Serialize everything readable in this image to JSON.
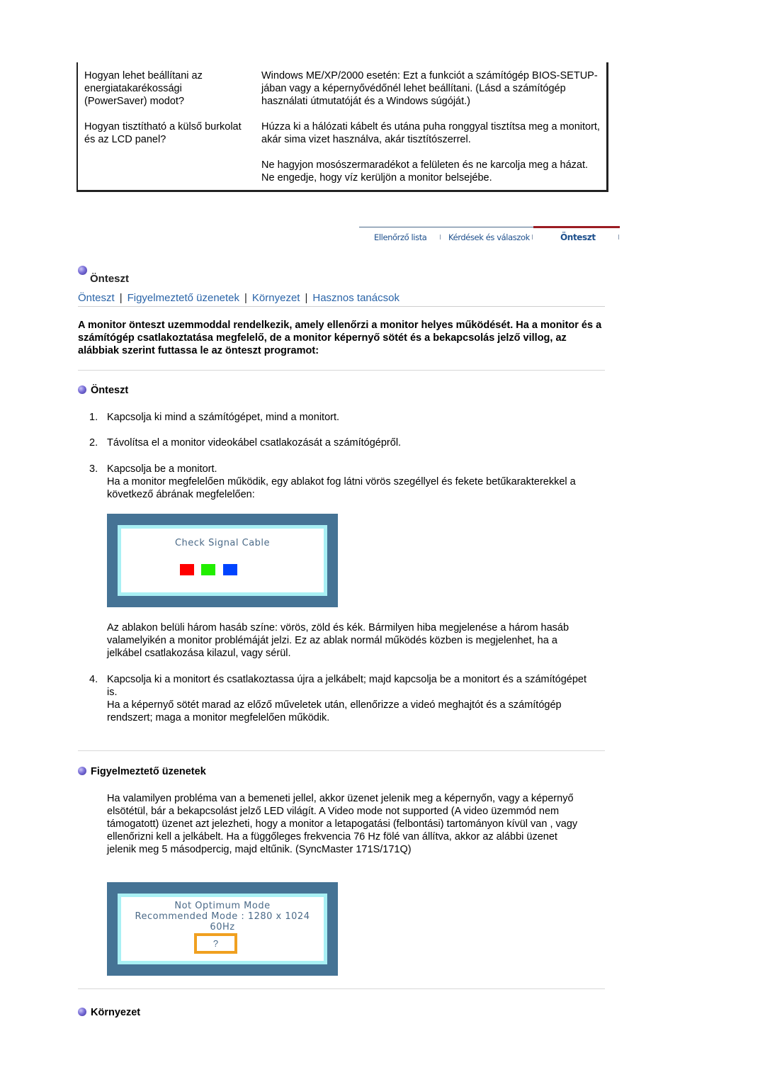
{
  "faq": [
    {
      "question": "Hogyan lehet beállítani az energiatakarékossági (PowerSaver) modot?",
      "answers": [
        "Windows ME/XP/2000 esetén: Ezt a funkciót a számítógép BIOS-SETUP-jában vagy a képernyővédőnél lehet beállítani. (Lásd a számítógép használati útmutatóját és a Windows súgóját.)"
      ]
    },
    {
      "question": "Hogyan tisztítható a külső burkolat és az LCD panel?",
      "answers": [
        "Húzza ki a hálózati kábelt és utána puha ronggyal tisztítsa meg a monitort, akár sima vizet használva, akár tisztítószerrel.",
        "Ne hagyjon mosószermaradékot a felületen és ne karcolja meg a házat. Ne engedje, hogy víz kerüljön a monitor belsejébe."
      ]
    }
  ],
  "tabs": [
    {
      "label": "Ellenőrző lista",
      "active": false
    },
    {
      "label": "Kérdések és válaszok",
      "active": false
    },
    {
      "label": "Önteszt",
      "active": true
    }
  ],
  "page_heading": "Önteszt",
  "subnav": [
    "Önteszt",
    "Figyelmeztető üzenetek",
    "Környezet",
    "Hasznos tanácsok"
  ],
  "intro": "A monitor önteszt uzemmoddal rendelkezik, amely ellenőrzi a monitor helyes működését. Ha a monitor és a számítógép csatlakoztatása megfelelő, de a monitor képernyő sötét és a bekapcsolás jelző villog, az alábbiak szerint futtassa le az önteszt programot:",
  "sections": {
    "selftest": {
      "title": "Önteszt",
      "steps": [
        {
          "num": "1.",
          "text": "Kapcsolja ki mind a számítógépet, mind a monitort."
        },
        {
          "num": "2.",
          "text": "Távolítsa el a monitor videokábel csatlakozását a számítógépről."
        },
        {
          "num": "3.",
          "text": "Kapcsolja be a monitort.",
          "detail": "Ha a monitor megfelelően működik, egy ablakot fog látni vörös szegéllyel és fekete betűkarakterekkel a következő ábrának megfelelően:"
        },
        {
          "num": "4.",
          "text": "Kapcsolja ki a monitort és csatlakoztassa újra a jelkábelt; majd kapcsolja be a monitort és a számítógépet is.",
          "detail": "Ha a képernyő sötét marad az előző műveletek után, ellenőrizze a videó meghajtót és a számítógép rendszert; maga a monitor megfelelően működik."
        }
      ],
      "osd_text": "Check Signal Cable",
      "osd_squares": [
        "#ff0000",
        "#22ee00",
        "#0044ff"
      ],
      "after_figure": "Az ablakon belüli három hasáb színe: vörös, zöld és kék. Bármilyen hiba megjelenése a három hasáb valamelyikén a monitor problémáját jelzi. Ez az ablak normál működés közben is megjelenhet, ha a jelkábel csatlakozása kilazul, vagy sérül."
    },
    "warnings": {
      "title": "Figyelmeztető üzenetek",
      "text": "Ha valamilyen probléma van a bemeneti jellel, akkor üzenet jelenik meg a képernyőn, vagy a képernyő elsötétül, bár a bekapcsolást jelző LED világít. A Video mode not supported (A video üzemmód nem támogatott) üzenet azt jelezheti, hogy a monitor a letapogatási (felbontási) tartományon kívül van , vagy ellenőrizni kell a jelkábelt. Ha a függőleges frekvencia 76 Hz fölé van állítva, akkor az alábbi üzenet jelenik meg 5 másodpercig, majd eltűnik. (SyncMaster 171S/171Q)",
      "osd_line1": "Not Optimum Mode",
      "osd_line2": "Recommended Mode : 1280 x 1024  60Hz",
      "osd_button": "?"
    },
    "environment": {
      "title": "Környezet"
    }
  }
}
